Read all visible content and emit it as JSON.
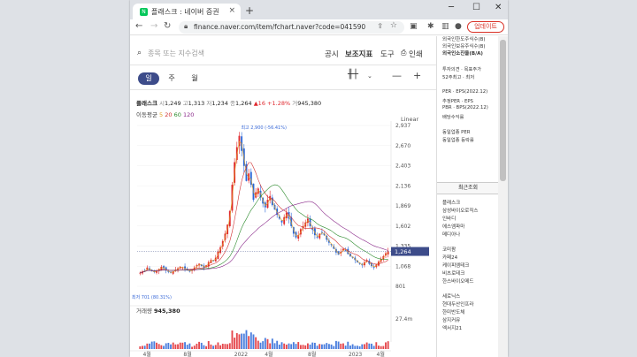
{
  "browser": {
    "tab_title": "플래스크 : 네이버 증권",
    "url": "finance.naver.com/item/fchart.naver?code=041590",
    "update_label": "업데이트",
    "new_tab": "+",
    "close": "×"
  },
  "search": {
    "placeholder": "종목 또는 지수검색"
  },
  "menu": [
    "공시",
    "보조지표",
    "도구",
    "인쇄"
  ],
  "periods": [
    "일",
    "주",
    "월"
  ],
  "stock": {
    "name": "플래스크",
    "open_label": "시",
    "open": "1,249",
    "high_label": "고",
    "high": "1,313",
    "low_label": "저",
    "low": "1,234",
    "close_label": "종",
    "close": "1,264",
    "change": "▲16",
    "change_pct": "+1.28%",
    "vol_label": "거",
    "volume": "945,380"
  },
  "ma": {
    "label": "이동평균",
    "periods": [
      "5",
      "20",
      "60",
      "120"
    ]
  },
  "scale_mode": "Linear",
  "chart_data": {
    "type": "candlestick",
    "price_ticks": [
      "2,937",
      "2,670",
      "2,403",
      "2,136",
      "1,869",
      "1,602",
      "1,335",
      "1,068",
      "801"
    ],
    "ylim": [
      801,
      2937
    ],
    "current_price": "1,264",
    "high_marker": "최고 2,900 (-56.41%)",
    "low_marker": "최저 701 (80.31%)",
    "volume_label": "거래량",
    "volume_value": "945,380",
    "volume_tick": "27.4m",
    "x_labels": [
      "4월",
      "8월",
      "2022",
      "4월",
      "8월",
      "2023",
      "4월"
    ],
    "close_series": [
      980,
      1000,
      1010,
      1050,
      1020,
      1000,
      990,
      1010,
      1030,
      1060,
      1040,
      1010,
      990,
      980,
      1000,
      1020,
      1040,
      1060,
      1050,
      1030,
      1010,
      1000,
      1020,
      1050,
      1080,
      1100,
      1070,
      1050,
      1080,
      1120,
      1150,
      1140,
      1180,
      1260,
      1320,
      1400,
      1500,
      1620,
      1800,
      2150,
      2450,
      2650,
      2800,
      2600,
      2400,
      2200,
      2300,
      2150,
      1950,
      2050,
      2100,
      1980,
      1900,
      1850,
      1950,
      2000,
      1880,
      1820,
      1750,
      1700,
      1650,
      1720,
      1780,
      1700,
      1600,
      1500,
      1450,
      1480,
      1560,
      1600,
      1650,
      1700,
      1600,
      1550,
      1480,
      1450,
      1500,
      1520,
      1480,
      1420,
      1380,
      1350,
      1300,
      1250,
      1220,
      1260,
      1300,
      1280,
      1230,
      1200,
      1180,
      1150,
      1120,
      1100,
      1080,
      1120,
      1150,
      1100,
      1070,
      1050,
      1090,
      1130,
      1160,
      1200,
      1240,
      1264
    ],
    "ma_colors": {
      "ma5": "#e0a020",
      "ma20": "#d03030",
      "ma60": "#2a8a2a",
      "ma120": "#8a2a8a"
    },
    "up_color": "#e0282e",
    "down_color": "#2a67d8"
  },
  "sidebar": {
    "top_items": [
      "외국인한도주식수(B)",
      "외국인보유주식수(B)",
      "외국인소진율(B/A)"
    ],
    "invest": [
      "투자의견 · 목표주가",
      "52주최고 · 최저"
    ],
    "per_items": [
      "PER · EPS(2022.12)",
      "추정PER · EPS",
      "PBR · BPS(2022.12)",
      "배당수익률"
    ],
    "industry": [
      "동일업종 PER",
      "동일업종 등락률"
    ],
    "recent_title": "최근조회",
    "recent": [
      "플래스크",
      "삼성바이오로직스",
      "인바디",
      "에스엠파마",
      "메디아나",
      "코미팜",
      "카페24",
      "케이피엠테크",
      "비츠로테크",
      "한스바이오메드",
      "세로닉스",
      "현대두산인프라",
      "한미반도체",
      "삼지커뮤",
      "엑서지21"
    ]
  }
}
